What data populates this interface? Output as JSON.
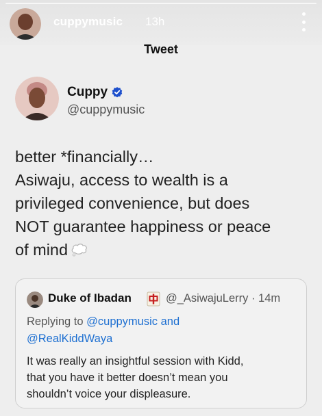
{
  "story": {
    "username": "cuppymusic",
    "time": "13h",
    "more_icon": "more-vertical-icon"
  },
  "header": {
    "title": "Tweet"
  },
  "author": {
    "name": "Cuppy",
    "handle": "@cuppymusic",
    "verified_icon": "verified-badge-icon",
    "verified_color": "#1d4fcc"
  },
  "tweet": {
    "lines": [
      "better *financially…",
      "Asiwaju, access to wealth is a",
      "privileged convenience, but does",
      "NOT guarantee happiness or peace",
      "of mind"
    ],
    "emoji_icon": "thought-balloon-icon"
  },
  "quote": {
    "name": "Duke of Ibadan",
    "flag_icon": "mahjong-red-dragon-icon",
    "handle_time": "@_AsiwajuLerry · 14m",
    "reply_prefix": "Replying to ",
    "reply_link_1": "@cuppymusic and",
    "reply_link_2": "@RealKiddWaya",
    "link_color": "#1d6fd1",
    "body_lines": [
      "It was really an insightful session with Kidd,",
      "that you have it better doesn’t mean you",
      "shouldn’t voice your displeasure."
    ]
  }
}
